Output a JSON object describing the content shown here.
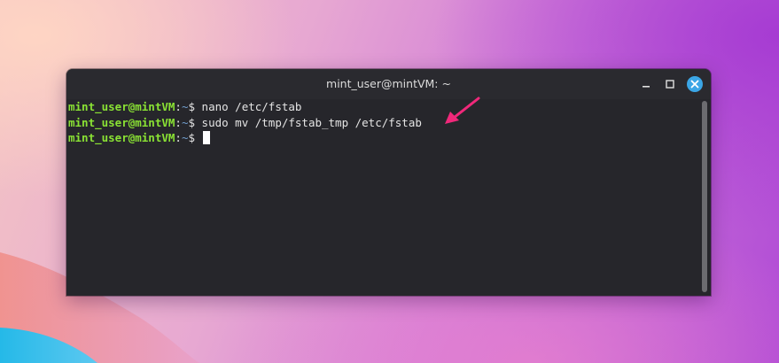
{
  "window": {
    "title": "mint_user@mintVM: ~"
  },
  "terminal": {
    "lines": [
      {
        "user_host": "mint_user@mintVM",
        "separator": ":",
        "path": "~",
        "sign": "$",
        "command": " nano /etc/fstab"
      },
      {
        "user_host": "mint_user@mintVM",
        "separator": ":",
        "path": "~",
        "sign": "$",
        "command": " sudo mv /tmp/fstab_tmp /etc/fstab"
      },
      {
        "user_host": "mint_user@mintVM",
        "separator": ":",
        "path": "~",
        "sign": "$",
        "command": " "
      }
    ]
  },
  "icons": {
    "minimize": "minimize-icon",
    "maximize": "maximize-icon",
    "close": "close-icon",
    "annotation": "arrow-annotation-icon"
  },
  "colors": {
    "terminal_bg": "#26262b",
    "prompt_user": "#8ae234",
    "prompt_path": "#729fcf",
    "close_button": "#3ba6e6",
    "annotation_arrow": "#f0287a"
  }
}
